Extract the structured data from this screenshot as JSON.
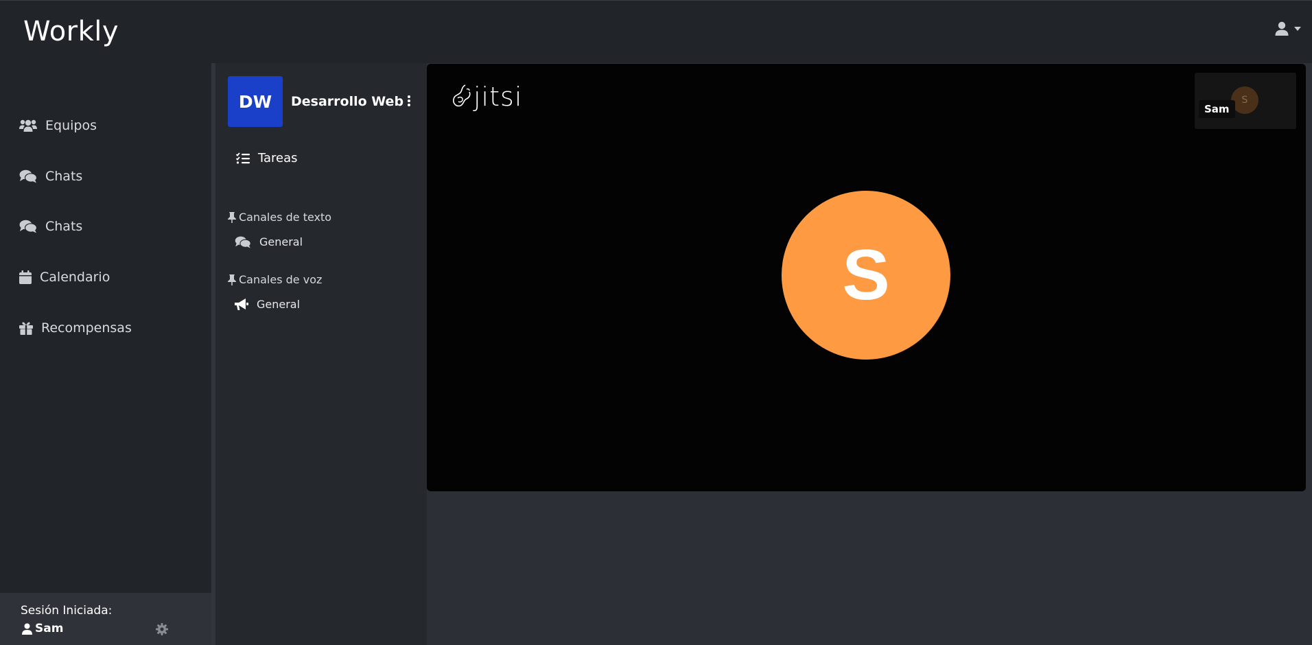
{
  "app": {
    "brand": "Workly"
  },
  "sidebar": {
    "items": [
      {
        "label": "Equipos",
        "icon": "users-icon"
      },
      {
        "label": "Chats",
        "icon": "comments-icon"
      },
      {
        "label": "Chats",
        "icon": "comments-icon"
      },
      {
        "label": "Calendario",
        "icon": "calendar-icon"
      },
      {
        "label": "Recompensas",
        "icon": "gift-icon"
      }
    ],
    "session": {
      "label": "Sesión Iniciada:",
      "user": "Sam"
    }
  },
  "team": {
    "initials": "DW",
    "name": "Desarrollo Web",
    "avatar_color": "#1a3fc9",
    "tasks_label": "Tareas",
    "text_channels": {
      "title": "Canales de texto",
      "channels": [
        "General"
      ]
    },
    "voice_channels": {
      "title": "Canales de voz",
      "channels": [
        "General"
      ]
    }
  },
  "meeting": {
    "logo": "jitsi",
    "participant_initial": "S",
    "participant_name": "Sam",
    "avatar_color": "#fe9a42"
  }
}
